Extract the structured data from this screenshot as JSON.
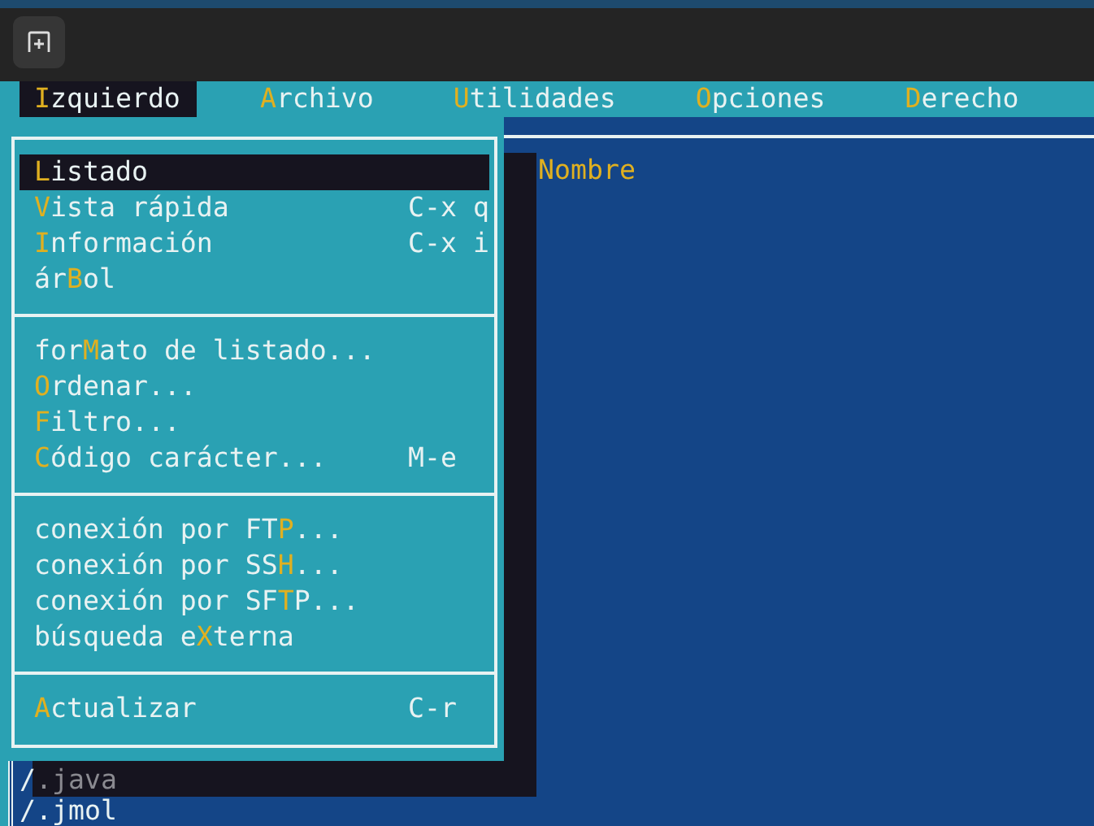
{
  "menubar": [
    {
      "hotkey": "I",
      "after": "zquierdo",
      "selected": true
    },
    {
      "hotkey": "A",
      "after": "rchivo",
      "selected": false
    },
    {
      "hotkey": "U",
      "after": "tilidades",
      "selected": false
    },
    {
      "hotkey": "O",
      "after": "pciones",
      "selected": false
    },
    {
      "hotkey": "D",
      "after": "erecho",
      "selected": false
    }
  ],
  "menu": {
    "sections": [
      [
        {
          "hotkey": "L",
          "after": "istado",
          "selected": true
        },
        {
          "hotkey": "V",
          "after": "ista rápida",
          "shortcut": "C-x q",
          "selected": false
        },
        {
          "hotkey": "I",
          "after": "nformación",
          "shortcut": "C-x i",
          "selected": false
        },
        {
          "before": "ár",
          "hotkey": "B",
          "after": "ol",
          "selected": false
        }
      ],
      [
        {
          "before": "for",
          "hotkey": "M",
          "after": "ato de listado...",
          "selected": false
        },
        {
          "hotkey": "O",
          "after": "rdenar...",
          "selected": false
        },
        {
          "hotkey": "F",
          "after": "iltro...",
          "selected": false
        },
        {
          "hotkey": "C",
          "after": "ódigo carácter...",
          "shortcut": "M-e",
          "selected": false
        }
      ],
      [
        {
          "before": "conexión por FT",
          "hotkey": "P",
          "after": "...",
          "selected": false
        },
        {
          "before": "conexión por SS",
          "hotkey": "H",
          "after": "...",
          "selected": false
        },
        {
          "before": "conexión por SF",
          "hotkey": "T",
          "after": "P...",
          "selected": false
        },
        {
          "before": "búsqueda e",
          "hotkey": "X",
          "after": "terna",
          "selected": false
        }
      ],
      [
        {
          "hotkey": "A",
          "after": "ctualizar",
          "shortcut": "C-r",
          "selected": false
        }
      ]
    ]
  },
  "panel": {
    "column_header": "Nombre",
    "files": [
      {
        "slash": "/",
        "name": ".java",
        "shaded": true
      },
      {
        "slash": "/",
        "name": ".jmol",
        "shaded": false
      }
    ]
  }
}
